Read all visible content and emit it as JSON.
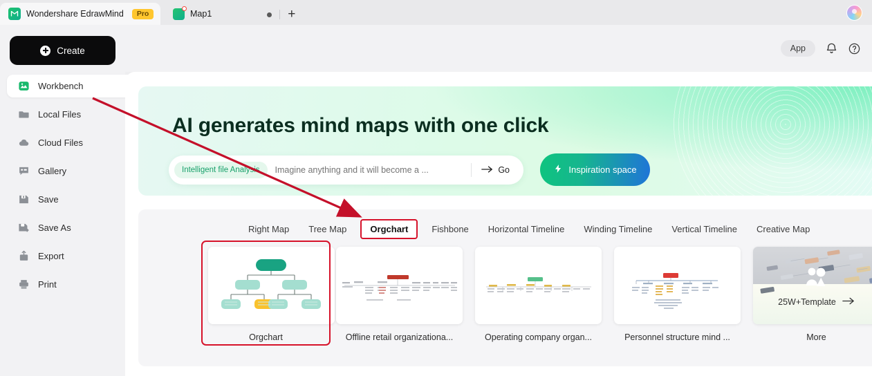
{
  "titlebar": {
    "app_tab": {
      "title": "Wondershare EdrawMind",
      "badge": "Pro",
      "logo_icon": "edrawmind-logo-icon"
    },
    "doc_tab": {
      "title": "Map1",
      "icon": "mindmap-file-icon",
      "unsaved_indicator": "unsaved-dot"
    },
    "controls": {
      "record_dot": "recording-dot-icon",
      "new_tab": "+"
    },
    "avatar_icon": "user-avatar"
  },
  "sidebar": {
    "create_label": "Create",
    "create_icon": "plus-circle-icon",
    "items": [
      {
        "label": "Workbench",
        "icon": "workbench-icon",
        "active": true
      },
      {
        "label": "Local Files",
        "icon": "folder-icon",
        "active": false
      },
      {
        "label": "Cloud Files",
        "icon": "cloud-icon",
        "active": false
      },
      {
        "label": "Gallery",
        "icon": "gallery-icon",
        "active": false
      },
      {
        "label": "Save",
        "icon": "save-icon",
        "active": false
      },
      {
        "label": "Save As",
        "icon": "save-as-icon",
        "active": false
      },
      {
        "label": "Export",
        "icon": "export-icon",
        "active": false
      },
      {
        "label": "Print",
        "icon": "print-icon",
        "active": false
      }
    ]
  },
  "topbar": {
    "app_button": "App",
    "notification_icon": "bell-icon",
    "help_icon": "question-circle-icon"
  },
  "banner": {
    "title": "AI generates mind maps with one click",
    "chip_label": "Intelligent file Analysis",
    "input_placeholder": "Imagine anything and it will become a ...",
    "input_value": "",
    "go_label": "Go",
    "go_icon": "arrow-right-icon",
    "inspiration_label": "Inspiration space",
    "inspiration_icon": "lightning-bolt-icon"
  },
  "templates": {
    "tabs": [
      {
        "label": "Right Map",
        "selected": false
      },
      {
        "label": "Tree Map",
        "selected": false
      },
      {
        "label": "Orgchart",
        "selected": true
      },
      {
        "label": "Fishbone",
        "selected": false
      },
      {
        "label": "Horizontal Timeline",
        "selected": false
      },
      {
        "label": "Winding Timeline",
        "selected": false
      },
      {
        "label": "Vertical Timeline",
        "selected": false
      },
      {
        "label": "Creative Map",
        "selected": false
      }
    ],
    "cards": [
      {
        "label": "Orgchart",
        "selected": true,
        "thumb": "orgchart-diagram"
      },
      {
        "label": "Offline retail organizationa...",
        "selected": false,
        "thumb": "offline-retail-diagram"
      },
      {
        "label": "Operating company organ...",
        "selected": false,
        "thumb": "operating-company-diagram"
      },
      {
        "label": "Personnel structure mind ...",
        "selected": false,
        "thumb": "personnel-structure-diagram"
      }
    ],
    "more_card": {
      "label": "More",
      "overlay_text": "25W+Template",
      "overlay_icon": "arrow-right-icon"
    }
  },
  "annotation": {
    "arrow_color": "#c4102a",
    "arrow_from": "workbench-sidebar-item",
    "arrow_to": "orgchart-tab",
    "highlight_color": "#d6122a"
  },
  "colors": {
    "accent_green": "#17a06a",
    "sidebar_bg": "#f2f2f4",
    "panel_bg": "#f5f5f7",
    "annotation_red": "#d6122a"
  }
}
